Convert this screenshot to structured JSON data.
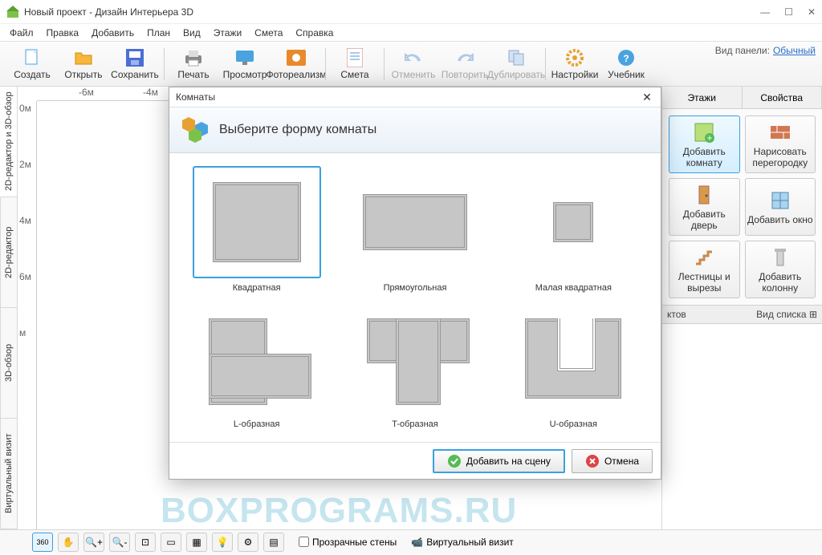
{
  "window": {
    "title": "Новый проект - Дизайн Интерьера 3D"
  },
  "menu": [
    "Файл",
    "Правка",
    "Добавить",
    "План",
    "Вид",
    "Этажи",
    "Смета",
    "Справка"
  ],
  "toolbar": {
    "create": "Создать",
    "open": "Открыть",
    "save": "Сохранить",
    "print": "Печать",
    "preview": "Просмотр",
    "photo": "Фотореализм",
    "estimate": "Смета",
    "undo": "Отменить",
    "redo": "Повторить",
    "duplicate": "Дублировать",
    "settings": "Настройки",
    "tutorial": "Учебник"
  },
  "panel_mode_label": "Вид панели:",
  "panel_mode_value": "Обычный",
  "left_tabs": [
    "2D-редактор и 3D-обзор",
    "2D-редактор",
    "3D-обзор",
    "Виртуальный визит"
  ],
  "ruler_h": [
    "-6м",
    "-4м"
  ],
  "ruler_v": [
    "0м",
    "2м",
    "4м",
    "6м",
    "м"
  ],
  "right_tabs": [
    "Этажи",
    "Свойства"
  ],
  "right_buttons": {
    "add_room": "Добавить комнату",
    "draw_wall": "Нарисовать перегородку",
    "add_door": "Добавить дверь",
    "add_window": "Добавить окно",
    "stairs": "Лестницы и вырезы",
    "add_column": "Добавить колонну"
  },
  "catalog_suffix": "ктов",
  "catalog_view": "Вид списка",
  "bottom": {
    "transparent": "Прозрачные стены",
    "virtual": "Виртуальный визит"
  },
  "watermark": "BOXPROGRAMS.RU",
  "dialog": {
    "title": "Комнаты",
    "heading": "Выберите форму комнаты",
    "shapes": {
      "square": "Квадратная",
      "rect": "Прямоугольная",
      "small": "Малая квадратная",
      "l": "L-образная",
      "t": "T-образная",
      "u": "U-образная"
    },
    "add": "Добавить на сцену",
    "cancel": "Отмена"
  }
}
